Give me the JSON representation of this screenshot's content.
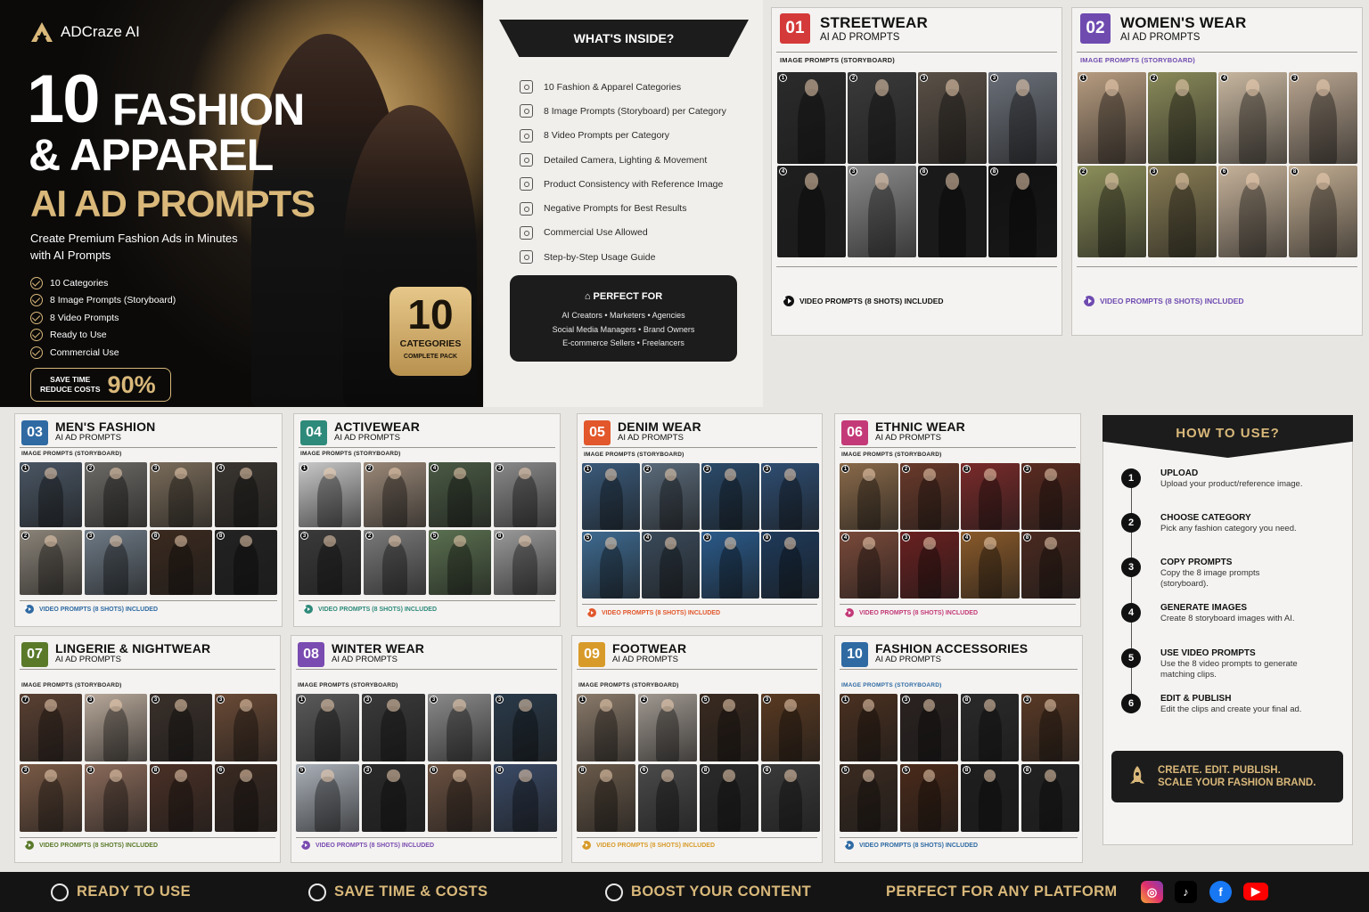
{
  "brand": {
    "name": "ADCraze AI"
  },
  "hero": {
    "number": "10",
    "line1": "FASHION",
    "line2": "& APPAREL",
    "line3": "AI AD PROMPTS",
    "subtitle": "Create Premium Fashion Ads in Minutes with AI Prompts",
    "checklist": [
      "10 Categories",
      "8 Image Prompts (Storyboard)",
      "8 Video Prompts",
      "Ready to Use",
      "Commercial Use"
    ],
    "save_line1": "SAVE TIME",
    "save_line2": "REDUCE COSTS",
    "save_value": "90%",
    "badge_number": "10",
    "badge_label": "CATEGORIES",
    "badge_sub": "COMPLETE PACK"
  },
  "inside": {
    "title": "WHAT'S INSIDE?",
    "features": [
      "10 Fashion & Apparel Categories",
      "8 Image Prompts (Storyboard) per Category",
      "8 Video Prompts per Category",
      "Detailed Camera, Lighting & Movement",
      "Product Consistency with Reference Image",
      "Negative Prompts for Best Results",
      "Commercial Use Allowed",
      "Step-by-Step Usage Guide"
    ],
    "perfect_title": "PERFECT FOR",
    "perfect_line1": "AI Creators  •  Marketers  •  Agencies",
    "perfect_line2": "Social Media Managers  •  Brand Owners",
    "perfect_line3": "E-commerce Sellers  •  Freelancers"
  },
  "cards": [
    {
      "num": "01",
      "title": "STREETWEAR",
      "sub": "AI AD PROMPTS",
      "img_label": "IMAGE PROMPTS (STORYBOARD)",
      "video_label": "VIDEO PROMPTS (8 SHOTS) INCLUDED",
      "color": "#d43a3a",
      "labels": [
        "1",
        "2",
        "3",
        "3",
        "4",
        "3",
        "8",
        "8"
      ],
      "tones": [
        "#2b2b2b",
        "#3a3a3a",
        "#5a5046",
        "#6a6f78",
        "#1e1e1e",
        "#8a8a8a",
        "#1a1a1a",
        "#111"
      ]
    },
    {
      "num": "02",
      "title": "WOMEN'S WEAR",
      "sub": "AI AD PROMPTS",
      "img_label": "IMAGE PROMPTS (STORYBOARD)",
      "video_label": "VIDEO PROMPTS (8 SHOTS) INCLUDED",
      "color": "#6f4bb0",
      "labels": [
        "1",
        "2",
        "4",
        "3",
        "2",
        "3",
        "6",
        "8"
      ],
      "tones": [
        "#b79c80",
        "#8a8a5a",
        "#c8b7a0",
        "#b9a590",
        "#8c8f5a",
        "#8a7e55",
        "#c6b29a",
        "#c2ad92"
      ]
    },
    {
      "num": "03",
      "title": "MEN'S FASHION",
      "sub": "AI AD PROMPTS",
      "img_label": "IMAGE PROMPTS (STORYBOARD)",
      "video_label": "VIDEO PROMPTS (8 SHOTS) INCLUDED",
      "color": "#2f6aa3",
      "labels": [
        "1",
        "2",
        "3",
        "4",
        "2",
        "3",
        "8",
        "8"
      ],
      "tones": [
        "#4a5664",
        "#6c6a66",
        "#7a6c5a",
        "#3a3530",
        "#8a8378",
        "#6e7a86",
        "#3b2a1f",
        "#222"
      ]
    },
    {
      "num": "04",
      "title": "ACTIVEWEAR",
      "sub": "AI AD PROMPTS",
      "img_label": "IMAGE PROMPTS (STORYBOARD)",
      "video_label": "VIDEO PROMPTS (8 SHOTS) INCLUDED",
      "color": "#2e8a7a",
      "labels": [
        "1",
        "2",
        "4",
        "3",
        "3",
        "2",
        "5",
        "8"
      ],
      "tones": [
        "#c9c9c9",
        "#9a8878",
        "#4a5a44",
        "#8a8a8a",
        "#3a3a3a",
        "#7a7a7a",
        "#5a7050",
        "#9a9a9a"
      ]
    },
    {
      "num": "05",
      "title": "DENIM WEAR",
      "sub": "AI AD PROMPTS",
      "img_label": "IMAGE PROMPTS (STORYBOARD)",
      "video_label": "VIDEO PROMPTS (8 SHOTS) INCLUDED",
      "color": "#e2572b",
      "labels": [
        "1",
        "2",
        "3",
        "3",
        "5",
        "4",
        "3",
        "8"
      ],
      "tones": [
        "#3a5a7a",
        "#5a6a7a",
        "#2a4a6a",
        "#2e4d72",
        "#3e6a90",
        "#3a4a5a",
        "#2a5a8a",
        "#1e3a5a"
      ]
    },
    {
      "num": "06",
      "title": "ETHNIC WEAR",
      "sub": "AI AD PROMPTS",
      "img_label": "IMAGE PROMPTS (STORYBOARD)",
      "video_label": "VIDEO PROMPTS (8 SHOTS) INCLUDED",
      "color": "#c43a78",
      "labels": [
        "1",
        "2",
        "3",
        "3",
        "4",
        "3",
        "4",
        "8"
      ],
      "tones": [
        "#8a6a4a",
        "#6a3a2a",
        "#7a2a2a",
        "#5a2a20",
        "#7a4a3a",
        "#6a2020",
        "#8a5a2a",
        "#4a2a20"
      ]
    },
    {
      "num": "07",
      "title": "LINGERIE & NIGHTWEAR",
      "sub": "AI AD PROMPTS",
      "img_label": "IMAGE PROMPTS (STORYBOARD)",
      "video_label": "VIDEO PROMPTS (8 SHOTS) INCLUDED",
      "color": "#5a7a2a",
      "labels": [
        "7",
        "3",
        "3",
        "3",
        "3",
        "3",
        "8",
        "6"
      ],
      "tones": [
        "#5a4032",
        "#b8a89a",
        "#3a302a",
        "#6a4a36",
        "#7a5a46",
        "#8a6a5a",
        "#4a3026",
        "#3a2a22"
      ]
    },
    {
      "num": "08",
      "title": "WINTER WEAR",
      "sub": "AI AD PROMPTS",
      "img_label": "IMAGE PROMPTS (STORYBOARD)",
      "video_label": "VIDEO PROMPTS (8 SHOTS) INCLUDED",
      "color": "#7a4bb0",
      "labels": [
        "1",
        "3",
        "3",
        "3",
        "5",
        "3",
        "6",
        "8"
      ],
      "tones": [
        "#5a5a5a",
        "#3a3a3a",
        "#8a8a8a",
        "#2a3a4a",
        "#aab0b8",
        "#2a2a2a",
        "#6a5040",
        "#3a4a66"
      ]
    },
    {
      "num": "09",
      "title": "FOOTWEAR",
      "sub": "AI AD PROMPTS",
      "img_label": "IMAGE PROMPTS (STORYBOARD)",
      "video_label": "VIDEO PROMPTS (8 SHOTS) INCLUDED",
      "color": "#d89b2a",
      "labels": [
        "1",
        "2",
        "5",
        "3",
        "8",
        "6",
        "8",
        "8"
      ],
      "tones": [
        "#8a7a6a",
        "#a09890",
        "#3a2a20",
        "#5a3a22",
        "#6a5a4a",
        "#4a4a4a",
        "#2a2a2a",
        "#3a3a3a"
      ]
    },
    {
      "num": "10",
      "title": "FASHION ACCESSORIES",
      "sub": "AI AD PROMPTS",
      "img_label": "IMAGE PROMPTS (STORYBOARD)",
      "video_label": "VIDEO PROMPTS (8 SHOTS) INCLUDED",
      "color": "#2f6aa3",
      "labels": [
        "1",
        "3",
        "8",
        "3",
        "5",
        "5",
        "8",
        "8"
      ],
      "tones": [
        "#4a3020",
        "#2a2220",
        "#2a2a2a",
        "#5a3a26",
        "#3a2a20",
        "#4a2a1a",
        "#1e1e1e",
        "#222"
      ]
    }
  ],
  "how": {
    "title": "HOW TO USE?",
    "steps": [
      {
        "n": "1",
        "title": "UPLOAD",
        "desc": "Upload your product/reference image."
      },
      {
        "n": "2",
        "title": "CHOOSE CATEGORY",
        "desc": "Pick any fashion category you need."
      },
      {
        "n": "3",
        "title": "COPY PROMPTS",
        "desc": "Copy the 8 image prompts (storyboard)."
      },
      {
        "n": "4",
        "title": "GENERATE IMAGES",
        "desc": "Create 8 storyboard images with AI."
      },
      {
        "n": "5",
        "title": "USE VIDEO PROMPTS",
        "desc": "Use the 8 video prompts to generate matching clips."
      },
      {
        "n": "6",
        "title": "EDIT & PUBLISH",
        "desc": "Edit the clips and create your final ad."
      }
    ],
    "cta_line1": "CREATE. EDIT. PUBLISH.",
    "cta_line2": "SCALE YOUR FASHION BRAND."
  },
  "footer": {
    "items": [
      "READY TO USE",
      "SAVE TIME & COSTS",
      "BOOST YOUR CONTENT",
      "PERFECT FOR ANY PLATFORM"
    ],
    "social": [
      "instagram-icon",
      "tiktok-icon",
      "facebook-icon",
      "youtube-icon"
    ]
  }
}
